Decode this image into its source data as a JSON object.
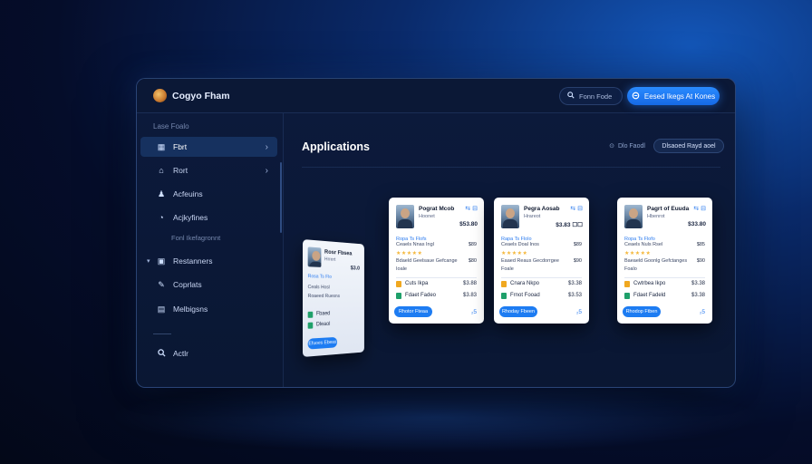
{
  "app": {
    "brand_name": "Cogyo Fham",
    "search_label": "Fonn Fode",
    "primary_button": "Eesed Ikegs At Kones"
  },
  "sidebar": {
    "section_label": "Lase Foalo",
    "items": [
      {
        "label": "Fbrt",
        "icon": "grid-icon",
        "active": true,
        "chevron": true
      },
      {
        "label": "Rort",
        "icon": "tag-icon",
        "active": false,
        "chevron": true
      },
      {
        "label": "Acfeuins",
        "icon": "users-icon",
        "active": false,
        "chevron": false
      },
      {
        "label": "Acjkyfines",
        "icon": "circle-icon",
        "active": false,
        "chevron": false
      },
      {
        "label": "Restanners",
        "icon": "briefcase-icon",
        "active": false,
        "chevron": false,
        "caret": true
      },
      {
        "label": "Coprlats",
        "icon": "pen-icon",
        "active": false,
        "chevron": false
      },
      {
        "label": "Melbigsns",
        "icon": "calendar-icon",
        "active": false,
        "chevron": false
      },
      {
        "label": "Actlr",
        "icon": "search-icon",
        "active": false,
        "chevron": false
      }
    ],
    "sub_item": "Fonl Ikefagronnt"
  },
  "main": {
    "title": "Applications",
    "filter_a": "Dlo Faodl",
    "filter_b": "Dlsaoed Rayd aoel"
  },
  "cards": [
    {
      "name": "Pograt Mcob",
      "role": "Hoonet",
      "price": "$53.80",
      "tag": "Ropa Ts Flofs",
      "line1": "Ceaels Nnas Ingl",
      "line1_val": "$89",
      "stars": "★★★★★",
      "line2": "Bdaeld Geelsaue Gefcange",
      "line2_val": "$80",
      "line3": "Ioale",
      "feat1": "Cuts Ikpa",
      "feat1_val": "$3.88",
      "feat2": "Fdaet Fadeo",
      "feat2_val": "$3.83",
      "button": "Rhotor Fteaa",
      "page": "₂5"
    },
    {
      "name": "Pegra Aosab",
      "role": "Hrareot",
      "price": "$3.83 ☐☐",
      "tag": "Rapa Ts Flolo",
      "line1": "Ceaels Doal Inos",
      "line1_val": "$89",
      "stars": "★★★★★",
      "line2": "Eaaed Reaus Gecdorrgee",
      "line2_val": "$90",
      "line3": "Foale",
      "feat1": "Cnara Nkpo",
      "feat1_val": "$3.38",
      "feat2": "Frnot Fooad",
      "feat2_val": "$3.53",
      "button": "Rhoday Fbeen",
      "page": "₂5"
    },
    {
      "name": "Pagrt of Euuda",
      "role": "Hbenrot",
      "price": "$33.80",
      "tag": "Ropa Ts Flofo",
      "line1": "Ceaels Nuls Rsel",
      "line1_val": "$85",
      "stars": "★★★★★",
      "line2": "Baeaeld Goonlg Gefctanges",
      "line2_val": "$90",
      "line3": "Foalo",
      "feat1": "Cwtrbea Ikpo",
      "feat1_val": "$3.38",
      "feat2": "Fdaet Fadeld",
      "feat2_val": "$3.38",
      "button": "Rhodop Ftben",
      "page": "₂5"
    }
  ],
  "tilted_card": {
    "name": "Rosr Fbsea",
    "role": "Hrrert",
    "price": "$3.0",
    "tag": "Rosa Ts Flo",
    "line1": "Ceals Hosl",
    "line2": "Roaeed Ruesns",
    "feat1": "Fbaed",
    "feat2": "Dleaol",
    "button": "Efuoes Ebeas"
  },
  "colors": {
    "accent": "#1d7cf2",
    "background": "#050d2a",
    "window": "#0c1a3c",
    "active_nav": "#16315f"
  }
}
